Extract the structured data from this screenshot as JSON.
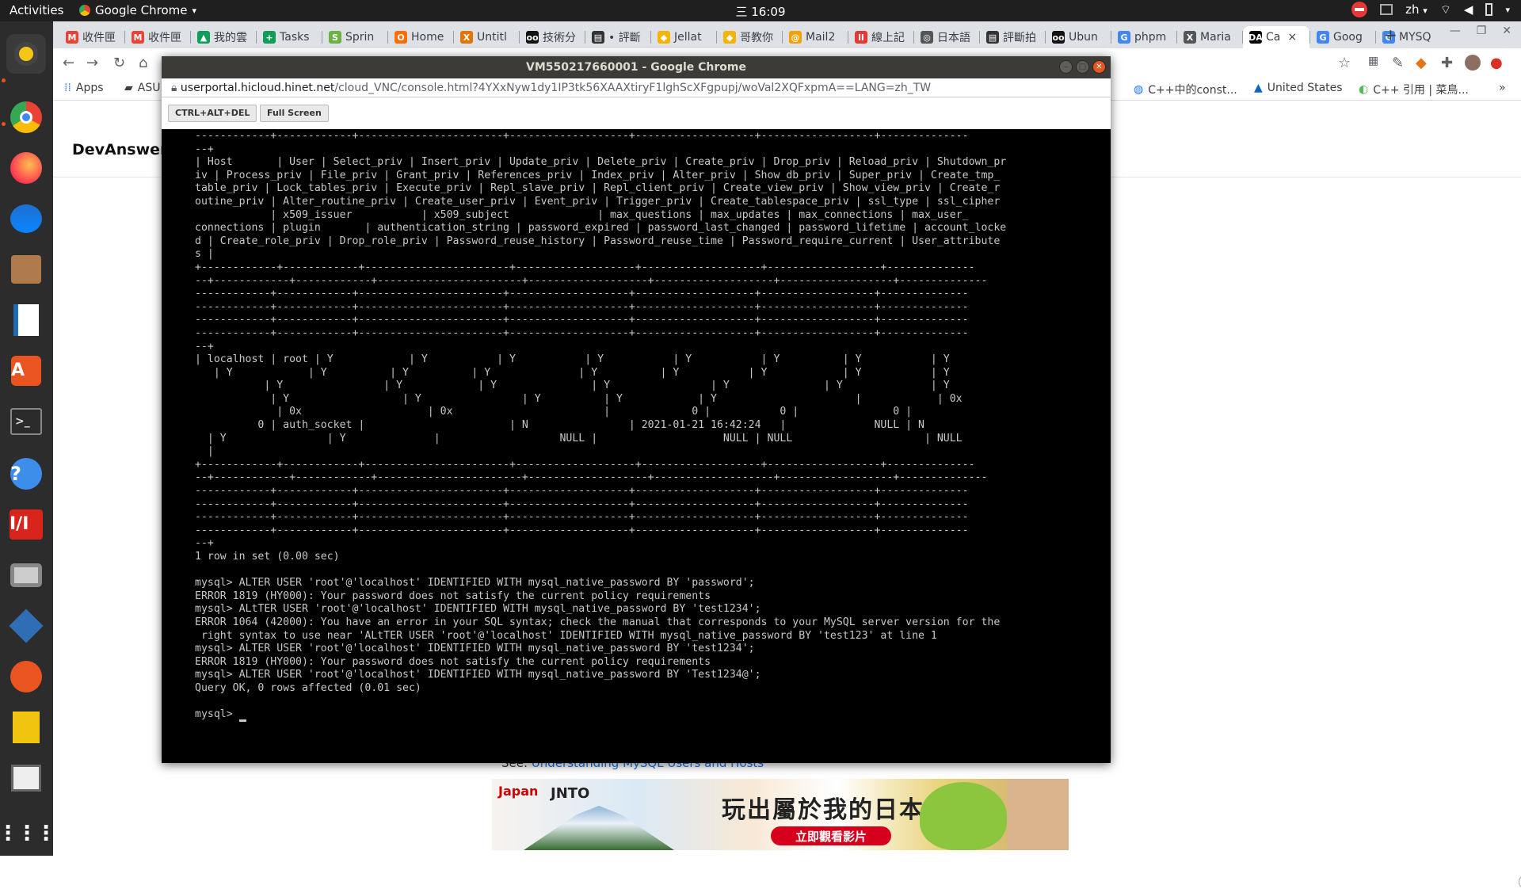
{
  "topbar": {
    "activities": "Activities",
    "app_name": "Google Chrome",
    "app_menu_glyph": "▾",
    "clock": "三 16:09",
    "lang": "zh",
    "lang_glyph": "▾"
  },
  "dock": {
    "icons": [
      "rhythmbox-icon",
      "chrome-icon",
      "firefox-icon",
      "thunderbird-icon",
      "files-icon",
      "writer-icon",
      "software-icon",
      "terminal-icon",
      "help-icon",
      "impress-icon",
      "screenshot-icon",
      "virtualbox-icon",
      "inkscape-icon",
      "pulse-icon",
      "photos-icon",
      "apps-grid-icon"
    ]
  },
  "tabs": [
    {
      "label": "收件匣",
      "fav": "M",
      "color": "#ea4335"
    },
    {
      "label": "收件匣",
      "fav": "M",
      "color": "#ea4335"
    },
    {
      "label": "我的雲",
      "fav": "▲",
      "color": "#0f9d58"
    },
    {
      "label": "Tasks",
      "fav": "+",
      "color": "#0f9d58"
    },
    {
      "label": "Sprin",
      "fav": "S",
      "color": "#6db33f"
    },
    {
      "label": "Home",
      "fav": "O",
      "color": "#ff6d00"
    },
    {
      "label": "Untitl",
      "fav": "X",
      "color": "#e37400"
    },
    {
      "label": "技術分",
      "fav": "oo",
      "color": "#111111"
    },
    {
      "label": "• 評斷",
      "fav": "▤",
      "color": "#333333"
    },
    {
      "label": "Jellat",
      "fav": "◆",
      "color": "#f4b400"
    },
    {
      "label": "哥教你",
      "fav": "◆",
      "color": "#f4b400"
    },
    {
      "label": "Mail2",
      "fav": "@",
      "color": "#f4a100"
    },
    {
      "label": "線上記",
      "fav": "ll",
      "color": "#e53935"
    },
    {
      "label": "日本語",
      "fav": "◎",
      "color": "#555555"
    },
    {
      "label": "評斷拍",
      "fav": "▤",
      "color": "#333333"
    },
    {
      "label": "Ubun",
      "fav": "oo",
      "color": "#111111"
    },
    {
      "label": "phpm",
      "fav": "G",
      "color": "#4285f4"
    },
    {
      "label": "Maria",
      "fav": "X",
      "color": "#555555"
    },
    {
      "label": "Ca",
      "fav": "DA",
      "color": "#000000",
      "active": true
    },
    {
      "label": "Goog",
      "fav": "G",
      "color": "#4285f4"
    },
    {
      "label": "MYSQ",
      "fav": "G",
      "color": "#4285f4"
    }
  ],
  "tab_close": "×",
  "new_tab": "+",
  "bookmarks": {
    "apps": "Apps",
    "asus": "ASU",
    "right": [
      {
        "label": "C++中的const..."
      },
      {
        "label": "United States"
      },
      {
        "label": "C++ 引用 | 菜鳥..."
      }
    ],
    "more": "»"
  },
  "page": {
    "site_title": "DevAnswers",
    "see_prefix": "See: ",
    "see_link": "Understanding MySQL Users and Hosts",
    "ad": {
      "brand": "Japan",
      "jnto": "JNTO",
      "headline": "玩出屬於我的日本",
      "cta": "立即觀看影片"
    }
  },
  "vnc": {
    "title": "VM550217660001 - Google Chrome",
    "url_host": "userportal.hicloud.hinet.net",
    "url_path": "/cloud_VNC/console.html?4YXxNyw1dy1IP3tk56XAAXtiryF1lghScXFgpupj/woVal2XQFxpmA==LANG=zh_TW",
    "btn_cad": "CTRL+ALT+DEL",
    "btn_fullscreen": "Full Screen",
    "terminal_lines": [
      "------------+------------+-----------------------+-------------------+-------------------+------------------+--------------",
      "--+",
      "| Host       | User | Select_priv | Insert_priv | Update_priv | Delete_priv | Create_priv | Drop_priv | Reload_priv | Shutdown_pr",
      "iv | Process_priv | File_priv | Grant_priv | References_priv | Index_priv | Alter_priv | Show_db_priv | Super_priv | Create_tmp_",
      "table_priv | Lock_tables_priv | Execute_priv | Repl_slave_priv | Repl_client_priv | Create_view_priv | Show_view_priv | Create_r",
      "outine_priv | Alter_routine_priv | Create_user_priv | Event_priv | Trigger_priv | Create_tablespace_priv | ssl_type | ssl_cipher",
      "            | x509_issuer           | x509_subject              | max_questions | max_updates | max_connections | max_user_",
      "connections | plugin       | authentication_string | password_expired | password_last_changed | password_lifetime | account_locke",
      "d | Create_role_priv | Drop_role_priv | Password_reuse_history | Password_reuse_time | Password_require_current | User_attribute",
      "s |",
      "+------------+------------+-----------------------+-------------------+-------------------+------------------+--------------",
      "--+------------+------------+-----------------------+-------------------+-------------------+------------------+--------------",
      "------------+------------+-----------------------+-------------------+-------------------+------------------+--------------",
      "------------+------------+-----------------------+-------------------+-------------------+------------------+--------------",
      "------------+------------+-----------------------+-------------------+-------------------+------------------+--------------",
      "------------+------------+-----------------------+-------------------+-------------------+------------------+--------------",
      "--+",
      "| localhost | root | Y            | Y           | Y           | Y           | Y           | Y          | Y           | Y",
      "   | Y            | Y          | Y          | Y              | Y          | Y           | Y            | Y           | Y",
      "           | Y                | Y            | Y               | Y                | Y               | Y              | Y",
      "            | Y                  | Y                | Y          | Y            | Y                      |            | 0x",
      "             | 0x                    | 0x                        |             0 |           0 |               0 |",
      "          0 | auth_socket |                       | N                | 2021-01-21 16:42:24   |              NULL | N",
      "  | Y                | Y              |                   NULL |                    NULL | NULL                     | NULL",
      "  |",
      "+------------+------------+-----------------------+-------------------+-------------------+------------------+--------------",
      "--+------------+------------+-----------------------+-------------------+-------------------+------------------+--------------",
      "------------+------------+-----------------------+-------------------+-------------------+------------------+--------------",
      "------------+------------+-----------------------+-------------------+-------------------+------------------+--------------",
      "------------+------------+-----------------------+-------------------+-------------------+------------------+--------------",
      "------------+------------+-----------------------+-------------------+-------------------+------------------+--------------",
      "--+",
      "1 row in set (0.00 sec)",
      "",
      "mysql> ALTER USER 'root'@'localhost' IDENTIFIED WITH mysql_native_password BY 'password';",
      "ERROR 1819 (HY000): Your password does not satisfy the current policy requirements",
      "mysql> ALtTER USER 'root'@'localhost' IDENTIFIED WITH mysql_native_password BY 'test1234';",
      "ERROR 1064 (42000): You have an error in your SQL syntax; check the manual that corresponds to your MySQL server version for the",
      " right syntax to use near 'ALtTER USER 'root'@'localhost' IDENTIFIED WITH mysql_native_password BY 'test123' at line 1",
      "mysql> ALTER USER 'root'@'localhost' IDENTIFIED WITH mysql_native_password BY 'test1234';",
      "ERROR 1819 (HY000): Your password does not satisfy the current policy requirements",
      "mysql> ALTER USER 'root'@'localhost' IDENTIFIED WITH mysql_native_password BY 'Test1234@';",
      "Query OK, 0 rows affected (0.01 sec)",
      ""
    ],
    "prompt": "mysql> "
  }
}
